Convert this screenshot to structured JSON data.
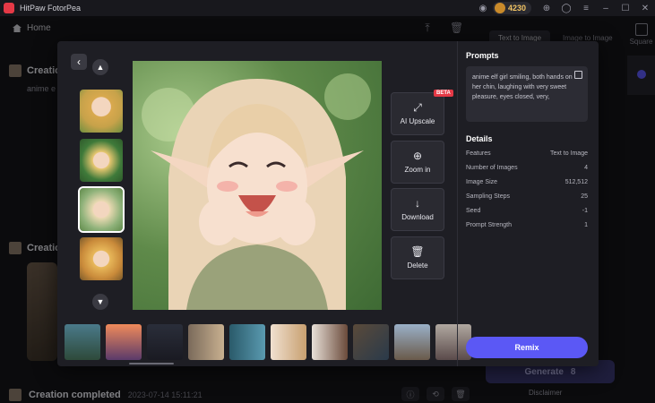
{
  "app": {
    "title": "HitPaw FotorPea",
    "coins": "4230"
  },
  "nav": {
    "home": "Home"
  },
  "background": {
    "tabs": [
      "Text to Image",
      "Image to Image"
    ],
    "square_label": "Square",
    "creation_title": "Creation",
    "creation_sub": "anime e",
    "creation_title_2": "Creation",
    "generate_label": "Generate",
    "generate_cost": "8",
    "disclaimer": "Disclaimer",
    "bottom_status": "Creation completed",
    "bottom_date": "2023-07-14  15:11:21"
  },
  "modal": {
    "buttons": {
      "upscale": "AI Upscale",
      "beta": "BETA",
      "zoom": "Zoom in",
      "download": "Download",
      "delete": "Delete"
    },
    "prompts_title": "Prompts",
    "prompt_text": "anime elf girl smiling, both hands on her chin, laughing with very sweet pleasure, eyes closed, very,",
    "details_title": "Details",
    "details": [
      {
        "label": "Features",
        "value": "Text to Image"
      },
      {
        "label": "Number of Images",
        "value": "4"
      },
      {
        "label": "Image Size",
        "value": "512,512"
      },
      {
        "label": "Sampling Steps",
        "value": "25"
      },
      {
        "label": "Seed",
        "value": "-1"
      },
      {
        "label": "Prompt Strength",
        "value": "1"
      }
    ],
    "remix_label": "Remix"
  },
  "colors": {
    "accent": "#5b58f5",
    "beta": "#e53946",
    "coin": "#f2c464"
  }
}
